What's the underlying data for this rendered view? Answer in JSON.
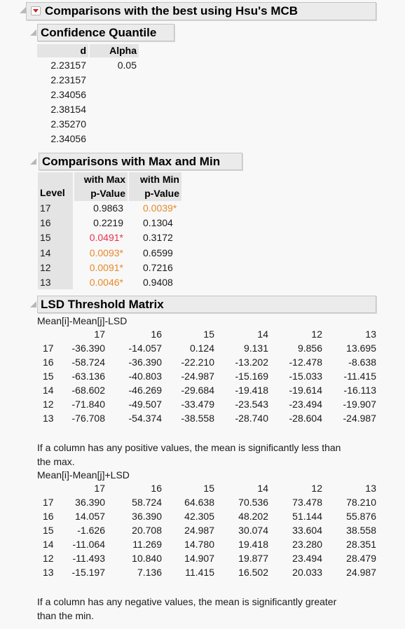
{
  "report": {
    "title": "Comparisons with the best using Hsu's MCB",
    "confidence_quantile": {
      "title": "Confidence Quantile",
      "columns": [
        "d",
        "Alpha"
      ],
      "d_values": [
        "2.23157",
        "2.23157",
        "2.34056",
        "2.38154",
        "2.35270",
        "2.34056"
      ],
      "alpha": "0.05"
    },
    "comparisons": {
      "title": "Comparisons with Max and Min",
      "col_level": "Level",
      "col_max_line1": "with Max",
      "col_max_line2": "p-Value",
      "col_min_line1": "with Min",
      "col_min_line2": "p-Value",
      "rows": [
        {
          "level": "17",
          "with_max": "0.9863",
          "with_min": "0.0039*"
        },
        {
          "level": "16",
          "with_max": "0.2219",
          "with_min": "0.1304"
        },
        {
          "level": "15",
          "with_max": "0.0491*",
          "with_min": "0.3172"
        },
        {
          "level": "14",
          "with_max": "0.0093*",
          "with_min": "0.6599"
        },
        {
          "level": "12",
          "with_max": "0.0091*",
          "with_min": "0.7216"
        },
        {
          "level": "13",
          "with_max": "0.0046*",
          "with_min": "0.9408"
        }
      ],
      "colors": {
        "orange": "#e8892a",
        "red": "#e8334a"
      }
    },
    "lsd": {
      "title": "LSD Threshold Matrix",
      "levels": [
        "17",
        "16",
        "15",
        "14",
        "12",
        "13"
      ],
      "matrix1_label": "Mean[i]-Mean[j]-LSD",
      "matrix1": [
        [
          "-36.390",
          "-14.057",
          "0.124",
          "9.131",
          "9.856",
          "13.695"
        ],
        [
          "-58.724",
          "-36.390",
          "-22.210",
          "-13.202",
          "-12.478",
          "-8.638"
        ],
        [
          "-63.136",
          "-40.803",
          "-24.987",
          "-15.169",
          "-15.033",
          "-11.415"
        ],
        [
          "-68.602",
          "-46.269",
          "-29.684",
          "-19.418",
          "-19.614",
          "-16.113"
        ],
        [
          "-71.840",
          "-49.507",
          "-33.479",
          "-23.543",
          "-23.494",
          "-19.907"
        ],
        [
          "-76.708",
          "-54.374",
          "-38.558",
          "-28.740",
          "-28.604",
          "-24.987"
        ]
      ],
      "note1": "If a column has any positive values, the mean is significantly less than the max.",
      "matrix2_label": "Mean[i]-Mean[j]+LSD",
      "matrix2": [
        [
          "36.390",
          "58.724",
          "64.638",
          "70.536",
          "73.478",
          "78.210"
        ],
        [
          "14.057",
          "36.390",
          "42.305",
          "48.202",
          "51.144",
          "55.876"
        ],
        [
          "-1.626",
          "20.708",
          "24.987",
          "30.074",
          "33.604",
          "38.558"
        ],
        [
          "-11.064",
          "11.269",
          "14.780",
          "19.418",
          "23.280",
          "28.351"
        ],
        [
          "-11.493",
          "10.840",
          "14.907",
          "19.877",
          "23.494",
          "28.479"
        ],
        [
          "-15.197",
          "7.136",
          "11.415",
          "16.502",
          "20.033",
          "24.987"
        ]
      ],
      "note2": "If a column has any negative values, the mean is significantly greater than the min."
    }
  }
}
